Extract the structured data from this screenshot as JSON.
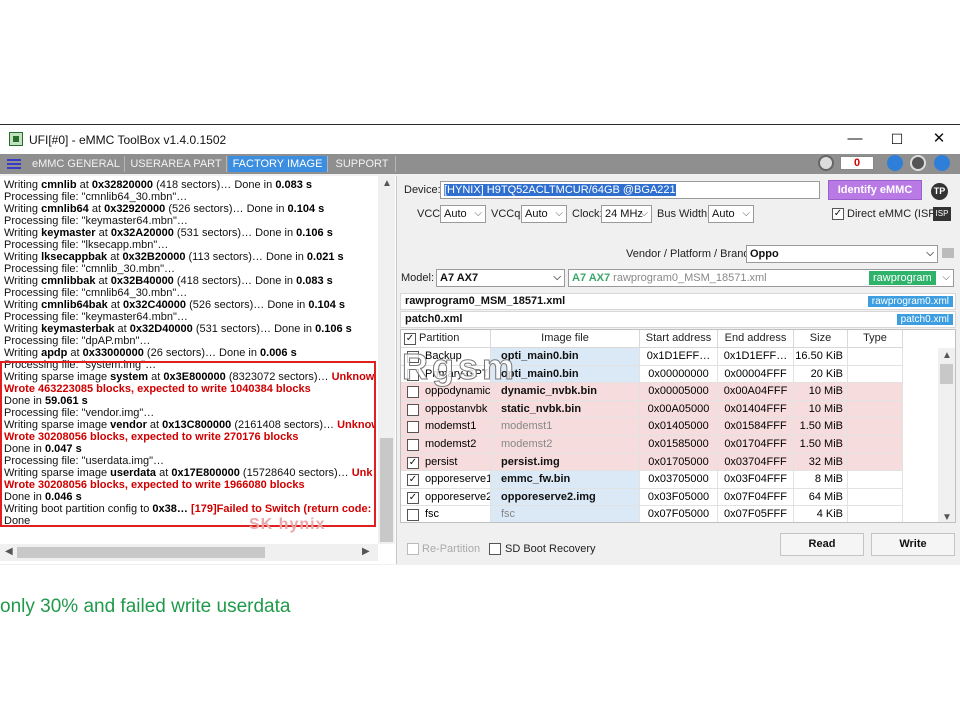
{
  "window": {
    "title": "UFI[#0] - eMMC ToolBox v1.4.0.1502",
    "minimize": "—",
    "maximize": "☐",
    "close": "✕"
  },
  "tabs": [
    {
      "label": "eMMC GENERAL"
    },
    {
      "label": "USERAREA PART"
    },
    {
      "label": "FACTORY IMAGE"
    },
    {
      "label": "SUPPORT"
    }
  ],
  "header": {
    "counter": "0"
  },
  "log": {
    "lines": [
      {
        "t": "Writing ",
        "b": "cmnlib",
        "t2": " at ",
        "b2": "0x32820000",
        "t3": " (418 sectors)… Done in ",
        "b3": "0.083 s",
        "r": ""
      },
      {
        "t": "Processing file: \"cmnlib64_30.mbn\"…",
        "b": "",
        "t2": "",
        "b2": "",
        "t3": "",
        "b3": "",
        "r": ""
      },
      {
        "t": "Writing ",
        "b": "cmnlib64",
        "t2": " at ",
        "b2": "0x32920000",
        "t3": " (526 sectors)… Done in ",
        "b3": "0.104 s",
        "r": ""
      },
      {
        "t": "Processing file: \"keymaster64.mbn\"…",
        "b": "",
        "t2": "",
        "b2": "",
        "t3": "",
        "b3": "",
        "r": ""
      },
      {
        "t": "Writing ",
        "b": "keymaster",
        "t2": " at ",
        "b2": "0x32A20000",
        "t3": " (531 sectors)… Done in ",
        "b3": "0.106 s",
        "r": ""
      },
      {
        "t": "Processing file: \"lksecapp.mbn\"…",
        "b": "",
        "t2": "",
        "b2": "",
        "t3": "",
        "b3": "",
        "r": ""
      },
      {
        "t": "Writing ",
        "b": "lksecappbak",
        "t2": " at ",
        "b2": "0x32B20000",
        "t3": " (113 sectors)… Done in ",
        "b3": "0.021 s",
        "r": ""
      },
      {
        "t": "Processing file: \"cmnlib_30.mbn\"…",
        "b": "",
        "t2": "",
        "b2": "",
        "t3": "",
        "b3": "",
        "r": ""
      },
      {
        "t": "Writing ",
        "b": "cmnlibbak",
        "t2": " at ",
        "b2": "0x32B40000",
        "t3": " (418 sectors)… Done in ",
        "b3": "0.083 s",
        "r": ""
      },
      {
        "t": "Processing file: \"cmnlib64_30.mbn\"…",
        "b": "",
        "t2": "",
        "b2": "",
        "t3": "",
        "b3": "",
        "r": ""
      },
      {
        "t": "Writing ",
        "b": "cmnlib64bak",
        "t2": " at ",
        "b2": "0x32C40000",
        "t3": " (526 sectors)… Done in ",
        "b3": "0.104 s",
        "r": ""
      },
      {
        "t": "Processing file: \"keymaster64.mbn\"…",
        "b": "",
        "t2": "",
        "b2": "",
        "t3": "",
        "b3": "",
        "r": ""
      },
      {
        "t": "Writing ",
        "b": "keymasterbak",
        "t2": " at ",
        "b2": "0x32D40000",
        "t3": " (531 sectors)… Done in ",
        "b3": "0.106 s",
        "r": ""
      },
      {
        "t": "Processing file: \"dpAP.mbn\"…",
        "b": "",
        "t2": "",
        "b2": "",
        "t3": "",
        "b3": "",
        "r": ""
      },
      {
        "t": "Writing ",
        "b": "apdp",
        "t2": " at ",
        "b2": "0x33000000",
        "t3": " (26 sectors)… Done in ",
        "b3": "0.006 s",
        "r": ""
      },
      {
        "t": "Processing file: \"system.img\"…",
        "b": "",
        "t2": "",
        "b2": "",
        "t3": "",
        "b3": "",
        "r": ""
      },
      {
        "t": "Writing sparse image ",
        "b": "system",
        "t2": " at ",
        "b2": "0x3E800000",
        "t3": " (8323072 sectors)… ",
        "b3": "",
        "r": "Unknow"
      },
      {
        "t": "",
        "b": "",
        "t2": "",
        "b2": "",
        "t3": "",
        "b3": "",
        "r": "Wrote 463223085 blocks, expected to write 1040384 blocks"
      },
      {
        "t": "Done in ",
        "b": "59.061 s",
        "t2": "",
        "b2": "",
        "t3": "",
        "b3": "",
        "r": ""
      },
      {
        "t": "Processing file: \"vendor.img\"…",
        "b": "",
        "t2": "",
        "b2": "",
        "t3": "",
        "b3": "",
        "r": ""
      },
      {
        "t": "Writing sparse image ",
        "b": "vendor",
        "t2": " at ",
        "b2": "0x13C800000",
        "t3": " (2161408 sectors)… ",
        "b3": "",
        "r": "Unknow"
      },
      {
        "t": "",
        "b": "",
        "t2": "",
        "b2": "",
        "t3": "",
        "b3": "",
        "r": "Wrote 30208056 blocks, expected to write 270176 blocks"
      },
      {
        "t": "Done in ",
        "b": "0.047 s",
        "t2": "",
        "b2": "",
        "t3": "",
        "b3": "",
        "r": ""
      },
      {
        "t": "Processing file: \"userdata.img\"…",
        "b": "",
        "t2": "",
        "b2": "",
        "t3": "",
        "b3": "",
        "r": ""
      },
      {
        "t": "Writing sparse image ",
        "b": "userdata",
        "t2": " at ",
        "b2": "0x17E800000",
        "t3": " (15728640 sectors)… ",
        "b3": "",
        "r": "Unk"
      },
      {
        "t": "",
        "b": "",
        "t2": "",
        "b2": "",
        "t3": "",
        "b3": "",
        "r": "Wrote 30208056 blocks, expected to write 1966080 blocks"
      },
      {
        "t": "Done in ",
        "b": "0.046 s",
        "t2": "",
        "b2": "",
        "t3": "",
        "b3": "",
        "r": ""
      },
      {
        "t": "Writing boot partition config to ",
        "b": "0x38…",
        "t2": " ",
        "b2": "",
        "t3": "",
        "b3": "",
        "r": "[179]Failed to Switch (return code: 1"
      },
      {
        "t": "Done",
        "b": "",
        "t2": "",
        "b2": "",
        "t3": "",
        "b3": "",
        "r": ""
      }
    ],
    "watermark": "SK hynix"
  },
  "device": {
    "label": "Device:",
    "value": "[HYNIX] H9TQ52ACLTMCUR/64GB  @BGA221",
    "identify_button": "Identify eMMC",
    "tp": "TP",
    "vcc_label": "VCC:",
    "vcc": "Auto",
    "vccq_label": "VCCq:",
    "vccq": "Auto",
    "clock_label": "Clock:",
    "clock": "24 MHz",
    "buswidth_label": "Bus Width:",
    "buswidth": "Auto",
    "direct_label": "Direct eMMC (ISP)",
    "isp": "ISP"
  },
  "vendor": {
    "label": "Vendor / Platform / Brand:",
    "value": "Oppo"
  },
  "model": {
    "label": "Model:",
    "value": "A7 AX7",
    "program_bold": "A7 AX7",
    "program": "rawprogram0_MSM_18571.xml",
    "program_tag": "rawprogram"
  },
  "xml_files": [
    {
      "name": "rawprogram0_MSM_18571.xml",
      "tag": "rawprogram0.xml"
    },
    {
      "name": "patch0.xml",
      "tag": "patch0.xml"
    }
  ],
  "grid": {
    "columns": [
      "Partition",
      "Image file",
      "Start address",
      "End address",
      "Size",
      "Type"
    ],
    "rows": [
      {
        "checked": false,
        "partition": "Backup",
        "image": "opti_main0.bin",
        "start": "0x1D1EFF…",
        "end": "0x1D1EFF…",
        "size": "16.50 KiB",
        "bg": "#ffffff",
        "imgbg": "#dbe8f5",
        "bold": true
      },
      {
        "checked": false,
        "partition": "Primary GPT",
        "image": "opti_main0.bin",
        "start": "0x00000000",
        "end": "0x00004FFF",
        "size": "20 KiB",
        "bg": "#ffffff",
        "imgbg": "#dbe8f5",
        "bold": true
      },
      {
        "checked": false,
        "partition": "oppodynamicvbk",
        "image": "dynamic_nvbk.bin",
        "start": "0x00005000",
        "end": "0x00A04FFF",
        "size": "10 MiB",
        "bg": "#f6dcdc",
        "imgbg": "#f6dcdc",
        "bold": true
      },
      {
        "checked": false,
        "partition": "oppostanvbk",
        "image": "static_nvbk.bin",
        "start": "0x00A05000",
        "end": "0x01404FFF",
        "size": "10 MiB",
        "bg": "#f6dcdc",
        "imgbg": "#f6dcdc",
        "bold": true
      },
      {
        "checked": false,
        "partition": "modemst1",
        "image": "modemst1",
        "start": "0x01405000",
        "end": "0x01584FFF",
        "size": "1.50 MiB",
        "bg": "#f6dcdc",
        "imgbg": "#f6dcdc",
        "bold": false
      },
      {
        "checked": false,
        "partition": "modemst2",
        "image": "modemst2",
        "start": "0x01585000",
        "end": "0x01704FFF",
        "size": "1.50 MiB",
        "bg": "#f6dcdc",
        "imgbg": "#f6dcdc",
        "bold": false
      },
      {
        "checked": true,
        "partition": "persist",
        "image": "persist.img",
        "start": "0x01705000",
        "end": "0x03704FFF",
        "size": "32 MiB",
        "bg": "#f6dcdc",
        "imgbg": "#f6dcdc",
        "bold": true
      },
      {
        "checked": true,
        "partition": "opporeserve1",
        "image": "emmc_fw.bin",
        "start": "0x03705000",
        "end": "0x03F04FFF",
        "size": "8 MiB",
        "bg": "#ffffff",
        "imgbg": "#dbe8f5",
        "bold": true
      },
      {
        "checked": true,
        "partition": "opporeserve2",
        "image": "opporeserve2.img",
        "start": "0x03F05000",
        "end": "0x07F04FFF",
        "size": "64 MiB",
        "bg": "#ffffff",
        "imgbg": "#dbe8f5",
        "bold": true
      },
      {
        "checked": false,
        "partition": "fsc",
        "image": "fsc",
        "start": "0x07F05000",
        "end": "0x07F05FFF",
        "size": "4 KiB",
        "bg": "#ffffff",
        "imgbg": "#dbe8f5",
        "bold": false
      }
    ]
  },
  "footer": {
    "repartition": "Re-Partition",
    "sdboot": "SD Boot Recovery",
    "read": "Read",
    "write": "Write"
  },
  "overlay": {
    "rgsm": "Rgsm"
  },
  "caption": "only 30% and failed write userdata"
}
